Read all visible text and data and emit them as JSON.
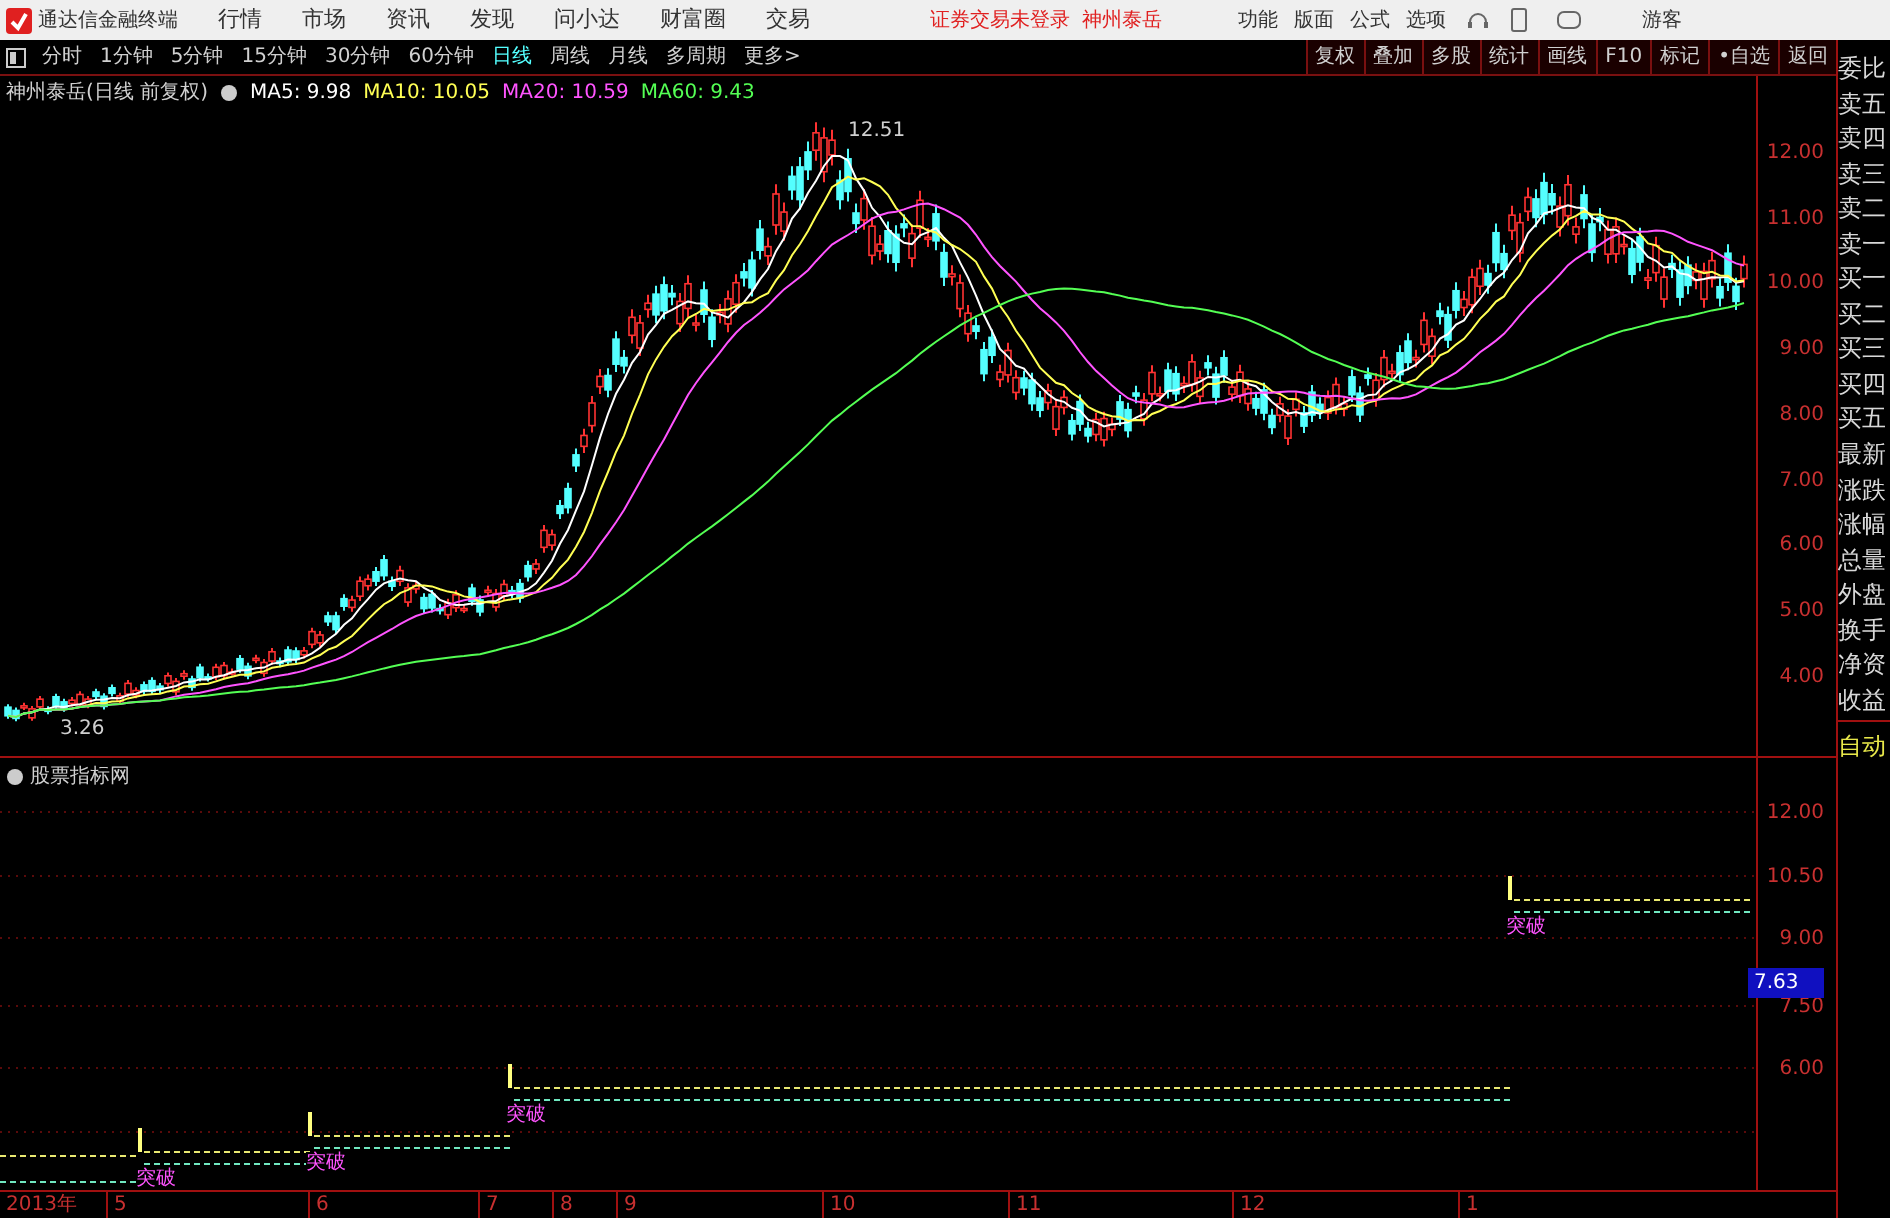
{
  "app": {
    "title": "通达信金融终端",
    "menu": [
      "行情",
      "市场",
      "资讯",
      "发现",
      "问小达",
      "财富圈",
      "交易"
    ],
    "login_status": "证券交易未登录",
    "current_stock": "神州泰岳",
    "tools": [
      "功能",
      "版面",
      "公式",
      "选项"
    ],
    "user": "游客"
  },
  "periods": [
    {
      "label": "分时",
      "selected": false
    },
    {
      "label": "1分钟",
      "selected": false
    },
    {
      "label": "5分钟",
      "selected": false
    },
    {
      "label": "15分钟",
      "selected": false
    },
    {
      "label": "30分钟",
      "selected": false
    },
    {
      "label": "60分钟",
      "selected": false
    },
    {
      "label": "日线",
      "selected": true
    },
    {
      "label": "周线",
      "selected": false
    },
    {
      "label": "月线",
      "selected": false
    },
    {
      "label": "多周期",
      "selected": false
    },
    {
      "label": "更多>",
      "selected": false
    }
  ],
  "chart_buttons": [
    "复权",
    "叠加",
    "多股",
    "统计",
    "画线",
    "F10",
    "标记",
    "•自选",
    "返回"
  ],
  "main_chart": {
    "title": "神州泰岳(日线 前复权)",
    "indicators": [
      {
        "label": "MA5: 9.98",
        "color": "#ffffff"
      },
      {
        "label": "MA10: 10.05",
        "color": "#ffff54"
      },
      {
        "label": "MA20: 10.59",
        "color": "#ff54ff"
      },
      {
        "label": "MA60: 9.43",
        "color": "#54ff54"
      }
    ],
    "high_label": "12.51",
    "low_label": "3.26",
    "price_axis": [
      "12.00",
      "11.00",
      "10.00",
      "9.00",
      "8.00",
      "7.00",
      "6.00",
      "5.00",
      "4.00"
    ]
  },
  "indicator_panel": {
    "title": "股票指标网",
    "signals": [
      "突破",
      "突破",
      "突破",
      "突破"
    ],
    "price_axis": [
      "12.00",
      "10.50",
      "9.00",
      "7.50",
      "6.00"
    ],
    "cursor_value": "7.63"
  },
  "time_axis": [
    "2013年",
    "5",
    "6",
    "7",
    "8",
    "9",
    "10",
    "11",
    "12",
    "1"
  ],
  "quote_panel": {
    "items": [
      "委比",
      "卖五",
      "卖四",
      "卖三",
      "卖二",
      "卖一",
      "买一",
      "买二",
      "买三",
      "买四",
      "买五",
      "最新",
      "涨跌",
      "涨幅",
      "总量",
      "外盘",
      "换手",
      "净资",
      "收益"
    ],
    "mode": "自动"
  }
}
